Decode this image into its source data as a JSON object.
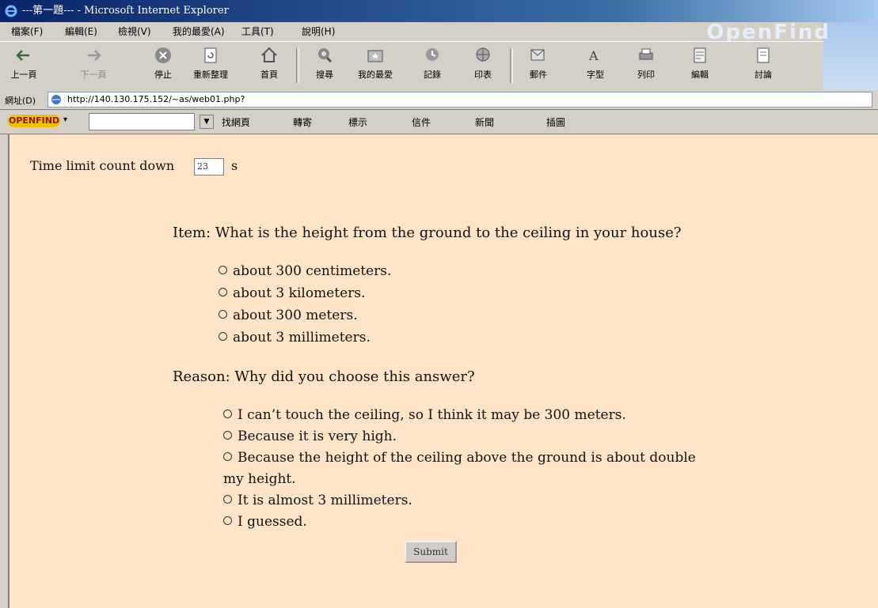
{
  "window": {
    "title": "---第一題--- - Microsoft Internet Explorer"
  },
  "menu": [
    "檔案(F)",
    "編輯(E)",
    "檢視(V)",
    "我的最愛(A)",
    "工具(T)",
    "說明(H)"
  ],
  "brand": "OpenFind",
  "toolbar": {
    "back": "上一頁",
    "forward": "下一頁",
    "stop": "停止",
    "refresh": "重新整理",
    "home": "首頁",
    "search": "搜尋",
    "favorites": "我的最愛",
    "history": "記錄",
    "print_layout": "印表",
    "mail": "郵件",
    "font": "字型",
    "print": "列印",
    "edit": "編輯",
    "discuss": "討論"
  },
  "address": {
    "label": "網址(D)",
    "url": "http://140.130.175.152/~as/web01.php?"
  },
  "openfind_bar": {
    "logo": "OPENFIND",
    "items": [
      "找網頁",
      "轉寄",
      "標示",
      "信件",
      "新聞",
      "插圖"
    ]
  },
  "quiz": {
    "timer_label": "Time limit count down",
    "timer_value": "23",
    "timer_unit": "s",
    "question": "Item: What is the height from the ground to the ceiling in your house?",
    "options": [
      "about 300 centimeters.",
      "about 3 kilometers.",
      "about 300 meters.",
      "about 3 millimeters."
    ],
    "reason_prompt": "Reason: Why did you choose this answer?",
    "reasons": [
      "I can’t touch the ceiling, so I think it may be 300 meters.",
      "Because it is very high.",
      "Because the height of the ceiling above the ground is about double",
      "my height.",
      "It is almost 3 millimeters.",
      "I guessed."
    ],
    "submit_label": "Submit"
  }
}
